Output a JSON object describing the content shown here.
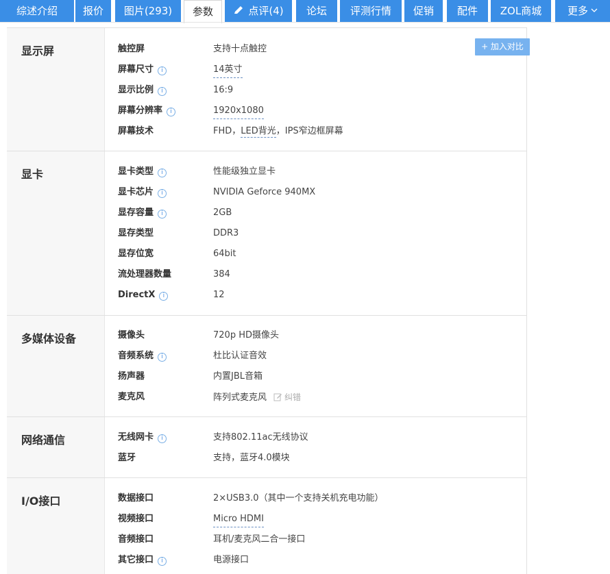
{
  "tabs": [
    {
      "label": "综述介绍"
    },
    {
      "label": "报价"
    },
    {
      "label": "图片(293)"
    },
    {
      "label": "参数"
    },
    {
      "label": "点评(4)"
    },
    {
      "label": "论坛"
    },
    {
      "label": "评测行情"
    },
    {
      "label": "促销"
    },
    {
      "label": "配件"
    },
    {
      "label": "ZOL商城"
    },
    {
      "label": "更多"
    }
  ],
  "compare_button": {
    "label": "+ 加入对比"
  },
  "sections": [
    {
      "name": "显示屏",
      "rows": [
        {
          "label": "触控屏",
          "value": "支持十点触控"
        },
        {
          "label": "屏幕尺寸",
          "value": "14英寸"
        },
        {
          "label": "显示比例",
          "value": "16:9"
        },
        {
          "label": "屏幕分辨率",
          "value": "1920x1080"
        },
        {
          "label": "屏幕技术",
          "value_parts": [
            "FHD，",
            "LED背光",
            "，IPS窄边框屏幕"
          ]
        }
      ]
    },
    {
      "name": "显卡",
      "rows": [
        {
          "label": "显卡类型",
          "value": "性能级独立显卡"
        },
        {
          "label": "显卡芯片",
          "value": "NVIDIA Geforce 940MX"
        },
        {
          "label": "显存容量",
          "value": "2GB"
        },
        {
          "label": "显存类型",
          "value": "DDR3"
        },
        {
          "label": "显存位宽",
          "value": "64bit"
        },
        {
          "label": "流处理器数量",
          "value": "384"
        },
        {
          "label": "DirectX",
          "value": "12"
        }
      ]
    },
    {
      "name": "多媒体设备",
      "rows": [
        {
          "label": "摄像头",
          "value": "720p HD摄像头"
        },
        {
          "label": "音频系统",
          "value": "杜比认证音效"
        },
        {
          "label": "扬声器",
          "value": "内置JBL音箱"
        },
        {
          "label": "麦克风",
          "value": "阵列式麦克风",
          "action": "纠错"
        }
      ]
    },
    {
      "name": "网络通信",
      "rows": [
        {
          "label": "无线网卡",
          "value": "支持802.11ac无线协议"
        },
        {
          "label": "蓝牙",
          "value": "支持，蓝牙4.0模块"
        }
      ]
    },
    {
      "name": "I/O接口",
      "rows": [
        {
          "label": "数据接口",
          "value": "2×USB3.0（其中一个支持关机充电功能）"
        },
        {
          "label": "视频接口",
          "value": "Micro HDMI"
        },
        {
          "label": "音频接口",
          "value": "耳机/麦克风二合一接口"
        },
        {
          "label": "其它接口",
          "value": "电源接口"
        }
      ]
    }
  ],
  "colors": {
    "tab_bg": "#3a8ee6",
    "compare_btn": "#77b2ef",
    "info_icon": "#4a90e2"
  }
}
